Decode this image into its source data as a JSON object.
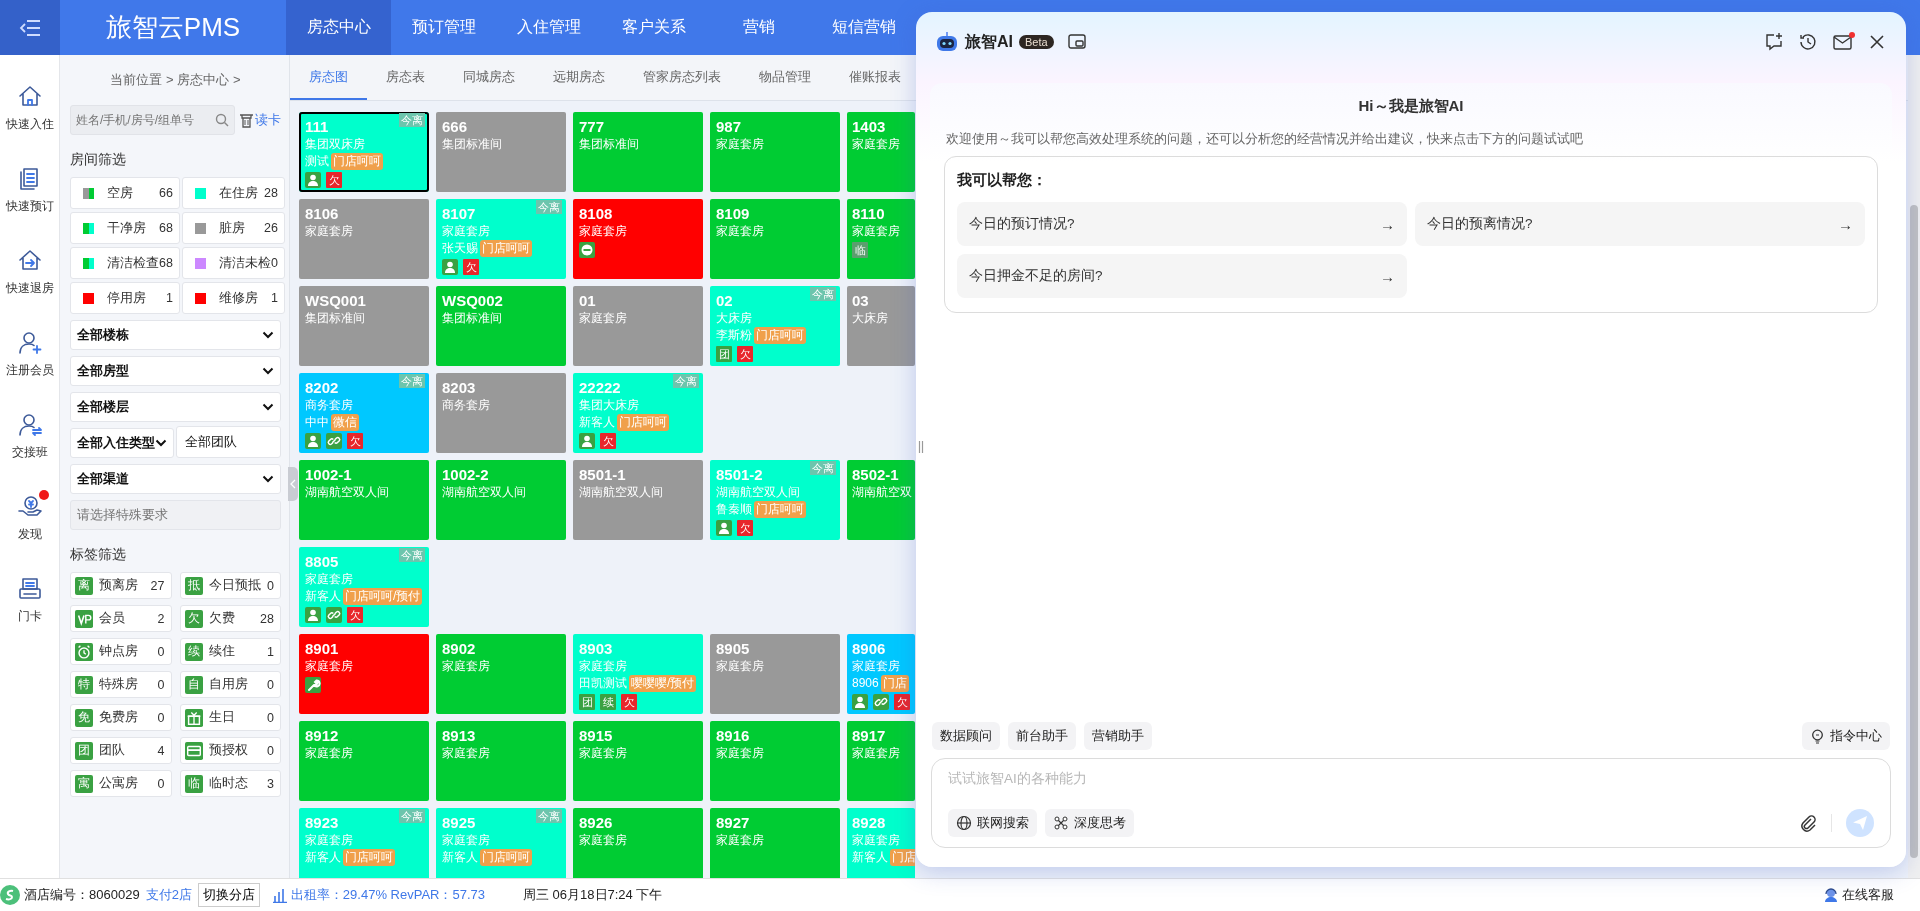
{
  "topbar": {
    "title": "旅智云PMS",
    "nav": [
      {
        "label": "房态中心",
        "selected": true
      },
      {
        "label": "预订管理",
        "selected": false
      },
      {
        "label": "入住管理",
        "selected": false
      },
      {
        "label": "客户关系",
        "selected": false
      },
      {
        "label": "营销",
        "selected": false
      },
      {
        "label": "短信营销",
        "selected": false
      }
    ]
  },
  "rail": [
    {
      "kind": "check-in",
      "label": "快速入住",
      "notify": false
    },
    {
      "kind": "booking",
      "label": "快速预订",
      "notify": false
    },
    {
      "kind": "check-out",
      "label": "快速退房",
      "notify": false
    },
    {
      "kind": "member",
      "label": "注册会员",
      "notify": false
    },
    {
      "kind": "shift",
      "label": "交接班",
      "notify": false
    },
    {
      "kind": "discover",
      "label": "发现",
      "notify": true
    },
    {
      "kind": "card",
      "label": "门卡",
      "notify": false
    }
  ],
  "filter": {
    "breadcrumb": "当前位置 > 房态中心 >",
    "search": {
      "placeholder": "姓名/手机/房号/组单号"
    },
    "card_reader": "读卡",
    "room_filter_title": "房间筛选",
    "legend": [
      {
        "label": "空房",
        "count": "66",
        "swatch": [
          {
            "color": "#999999"
          },
          {
            "color": "#00cc33"
          }
        ]
      },
      {
        "label": "在住房",
        "count": "28",
        "swatch": [
          {
            "color": "#00ffcc"
          }
        ]
      },
      {
        "label": "干净房",
        "count": "68",
        "swatch": [
          {
            "color": "#00cc33"
          },
          {
            "color": "#00ffcc"
          }
        ]
      },
      {
        "label": "脏房",
        "count": "26",
        "swatch": [
          {
            "color": "#999999"
          }
        ]
      },
      {
        "label": "清洁检查",
        "count": "68",
        "swatch": [
          {
            "color": "#00cc33"
          },
          {
            "color": "#00ffcc"
          }
        ]
      },
      {
        "label": "清洁未检",
        "count": "0",
        "swatch": [
          {
            "color": "#cc88ff"
          }
        ]
      },
      {
        "label": "停用房",
        "count": "1",
        "swatch": [
          {
            "color": "#ff0000"
          }
        ]
      },
      {
        "label": "维修房",
        "count": "1",
        "swatch": [
          {
            "color": "#ff0000"
          }
        ]
      }
    ],
    "selects": [
      {
        "kind": "select",
        "value": "全部楼栋"
      },
      {
        "kind": "select",
        "value": "全部房型"
      },
      {
        "kind": "select",
        "value": "全部楼层"
      },
      {
        "kind": "pair",
        "value": "全部入住类型",
        "extra": "全部团队"
      },
      {
        "kind": "select",
        "value": "全部渠道"
      }
    ],
    "special": {
      "placeholder": "请选择特殊要求"
    },
    "tag_filter_title": "标签筛选",
    "tags": [
      {
        "kind": "glyph",
        "glyph": "离",
        "label": "预离房",
        "count": "27"
      },
      {
        "kind": "glyph",
        "glyph": "抵",
        "label": "今日预抵",
        "count": "0"
      },
      {
        "kind": "vip",
        "label": "会员",
        "count": "2"
      },
      {
        "kind": "glyph",
        "glyph": "欠",
        "label": "欠费",
        "count": "28"
      },
      {
        "kind": "clock",
        "label": "钟点房",
        "count": "0"
      },
      {
        "kind": "glyph",
        "glyph": "续",
        "label": "续住",
        "count": "1"
      },
      {
        "kind": "glyph",
        "glyph": "特",
        "label": "特殊房",
        "count": "0"
      },
      {
        "kind": "glyph",
        "glyph": "自",
        "label": "自用房",
        "count": "0"
      },
      {
        "kind": "glyph",
        "glyph": "免",
        "label": "免费房",
        "count": "0"
      },
      {
        "kind": "gift",
        "label": "生日",
        "count": "0"
      },
      {
        "kind": "glyph",
        "glyph": "团",
        "label": "团队",
        "count": "4"
      },
      {
        "kind": "card",
        "label": "预授权",
        "count": "0"
      },
      {
        "kind": "glyph",
        "glyph": "寓",
        "label": "公寓房",
        "count": "0"
      },
      {
        "kind": "glyph",
        "glyph": "临",
        "label": "临时态",
        "count": "3"
      }
    ]
  },
  "subtabs": [
    {
      "label": "房态图",
      "selected": true
    },
    {
      "label": "房态表",
      "selected": false
    },
    {
      "label": "同城房态",
      "selected": false
    },
    {
      "label": "远期房态",
      "selected": false
    },
    {
      "label": "管家房态列表",
      "selected": false
    },
    {
      "label": "物品管理",
      "selected": false
    },
    {
      "label": "催账报表",
      "selected": false
    }
  ],
  "rooms": {
    "rows": [
      [
        {
          "number": "111",
          "type": "集团双床房",
          "guest": "测试",
          "tag": "门店呵呵",
          "departing": "今离",
          "color": "#00ffcc",
          "selected": true,
          "marks": [
            {
              "kind": "person"
            },
            {
              "kind": "label",
              "text": "欠",
              "color": "#e8262b"
            }
          ]
        },
        {
          "number": "666",
          "type": "集团标准间",
          "color": "#999999",
          "selected": false
        },
        {
          "number": "777",
          "type": "集团标准间",
          "color": "#00cc33",
          "selected": false
        },
        {
          "number": "987",
          "type": "家庭套房",
          "color": "#00cc33",
          "selected": false
        },
        {
          "number": "1403",
          "type": "家庭套房",
          "color": "#00cc33",
          "selected": false
        }
      ],
      [
        {
          "number": "8106",
          "type": "家庭套房",
          "color": "#999999",
          "selected": false
        },
        {
          "number": "8107",
          "type": "家庭套房",
          "guest": "张天赐",
          "tag": "门店呵呵",
          "departing": "今离",
          "color": "#00ffcc",
          "selected": false,
          "marks": [
            {
              "kind": "person"
            },
            {
              "kind": "label",
              "text": "欠",
              "color": "#e8262b"
            }
          ]
        },
        {
          "number": "8108",
          "type": "家庭套房",
          "color": "#ff0000",
          "selected": false,
          "marks": [
            {
              "kind": "blocked"
            }
          ]
        },
        {
          "number": "8109",
          "type": "家庭套房",
          "color": "#00cc33",
          "selected": false
        },
        {
          "number": "8110",
          "type": "家庭套房",
          "color": "#00cc33",
          "selected": false,
          "marks": [
            {
              "kind": "label",
              "text": "临",
              "color": "#5c9e6e"
            }
          ]
        }
      ],
      [
        {
          "number": "WSQ001",
          "type": "集团标准间",
          "color": "#999999",
          "selected": false
        },
        {
          "number": "WSQ002",
          "type": "集团标准间",
          "color": "#00cc33",
          "selected": false
        },
        {
          "number": "01",
          "type": "家庭套房",
          "color": "#999999",
          "selected": false
        },
        {
          "number": "02",
          "type": "大床房",
          "guest": "李斯粉",
          "tag": "门店呵呵",
          "departing": "今离",
          "color": "#00ffcc",
          "selected": false,
          "marks": [
            {
              "kind": "label",
              "text": "团",
              "color": "#3aa142"
            },
            {
              "kind": "label",
              "text": "欠",
              "color": "#e8262b"
            }
          ]
        },
        {
          "number": "03",
          "type": "大床房",
          "color": "#999999",
          "selected": false
        }
      ],
      [
        {
          "number": "8202",
          "type": "商务套房",
          "guest": "中中",
          "tag": "微信",
          "departing": "今离",
          "color": "#00c8ff",
          "selected": false,
          "marks": [
            {
              "kind": "person"
            },
            {
              "kind": "link"
            },
            {
              "kind": "label",
              "text": "欠",
              "color": "#e8262b"
            }
          ]
        },
        {
          "number": "8203",
          "type": "商务套房",
          "color": "#999999",
          "selected": false
        },
        {
          "number": "22222",
          "type": "集团大床房",
          "guest": "新客人",
          "tag": "门店呵呵",
          "departing": "今离",
          "color": "#00ffcc",
          "selected": false,
          "marks": [
            {
              "kind": "person"
            },
            {
              "kind": "label",
              "text": "欠",
              "color": "#e8262b"
            }
          ]
        }
      ],
      [
        {
          "number": "1002-1",
          "type": "湖南航空双人间",
          "color": "#00cc33",
          "selected": false
        },
        {
          "number": "1002-2",
          "type": "湖南航空双人间",
          "color": "#00cc33",
          "selected": false
        },
        {
          "number": "8501-1",
          "type": "湖南航空双人间",
          "color": "#999999",
          "selected": false
        },
        {
          "number": "8501-2",
          "type": "湖南航空双人间",
          "guest": "鲁秦顺",
          "tag": "门店呵呵",
          "departing": "今离",
          "color": "#00ffcc",
          "selected": false,
          "marks": [
            {
              "kind": "person"
            },
            {
              "kind": "label",
              "text": "欠",
              "color": "#e8262b"
            }
          ]
        },
        {
          "number": "8502-1",
          "type": "湖南航空双",
          "color": "#00cc33",
          "selected": false
        }
      ],
      [
        {
          "number": "8805",
          "type": "家庭套房",
          "guest": "新客人",
          "tag": "门店呵呵/预付",
          "departing": "今离",
          "color": "#00ffcc",
          "selected": false,
          "marks": [
            {
              "kind": "person"
            },
            {
              "kind": "link"
            },
            {
              "kind": "label",
              "text": "欠",
              "color": "#e8262b"
            }
          ]
        }
      ],
      [
        {
          "number": "8901",
          "type": "家庭套房",
          "color": "#ff0000",
          "selected": false,
          "marks": [
            {
              "kind": "repair"
            }
          ]
        },
        {
          "number": "8902",
          "type": "家庭套房",
          "color": "#00cc33",
          "selected": false
        },
        {
          "number": "8903",
          "type": "家庭套房",
          "guest": "田凯测试",
          "tag": "嘤嘤嘤/预付",
          "color": "#00ffcc",
          "selected": false,
          "marks": [
            {
              "kind": "label",
              "text": "团",
              "color": "#3aa142"
            },
            {
              "kind": "label",
              "text": "续",
              "color": "#3aa142"
            },
            {
              "kind": "label",
              "text": "欠",
              "color": "#e8262b"
            }
          ]
        },
        {
          "number": "8905",
          "type": "家庭套房",
          "color": "#999999",
          "selected": false
        },
        {
          "number": "8906",
          "type": "家庭套房",
          "guest": "8906",
          "tag": "门店",
          "color": "#00c8ff",
          "selected": false,
          "marks": [
            {
              "kind": "person"
            },
            {
              "kind": "link"
            },
            {
              "kind": "label",
              "text": "欠",
              "color": "#e8262b"
            }
          ]
        }
      ],
      [
        {
          "number": "8912",
          "type": "家庭套房",
          "color": "#00cc33",
          "selected": false
        },
        {
          "number": "8913",
          "type": "家庭套房",
          "color": "#00cc33",
          "selected": false
        },
        {
          "number": "8915",
          "type": "家庭套房",
          "color": "#00cc33",
          "selected": false
        },
        {
          "number": "8916",
          "type": "家庭套房",
          "color": "#00cc33",
          "selected": false
        },
        {
          "number": "8917",
          "type": "家庭套房",
          "color": "#00cc33",
          "selected": false
        }
      ],
      [
        {
          "number": "8923",
          "type": "家庭套房",
          "guest": "新客人",
          "tag": "门店呵呵",
          "departing": "今离",
          "color": "#00ffcc",
          "selected": false
        },
        {
          "number": "8925",
          "type": "家庭套房",
          "guest": "新客人",
          "tag": "门店呵呵",
          "departing": "今离",
          "color": "#00ffcc",
          "selected": false
        },
        {
          "number": "8926",
          "type": "家庭套房",
          "color": "#00cc33",
          "selected": false
        },
        {
          "number": "8927",
          "type": "家庭套房",
          "color": "#00cc33",
          "selected": false
        },
        {
          "number": "8928",
          "type": "家庭套房",
          "guest": "新客人",
          "tag": "门店",
          "color": "#00ffcc",
          "selected": false
        }
      ]
    ]
  },
  "ai_panel": {
    "title": "旅智AI",
    "badge": "Beta",
    "mail_unread": true,
    "greeting": "Hi～我是旅智AI",
    "intro": "欢迎使用～我可以帮您高效处理系统的问题，还可以分析您的经营情况并给出建议，快来点击下方的问题试试吧",
    "help_title": "我可以帮您：",
    "suggestions": [
      {
        "text": "今日的预订情况?",
        "arrow": "→"
      },
      {
        "text": "今日的预离情况?",
        "arrow": "→"
      },
      {
        "text": "今日押金不足的房间?",
        "arrow": "→"
      }
    ],
    "assistants": [
      "数据顾问",
      "前台助手",
      "营销助手"
    ],
    "command_center": "指令中心",
    "input": {
      "placeholder": "试试旅智AI的各种能力"
    },
    "tools": [
      {
        "kind": "web",
        "label": "联网搜索"
      },
      {
        "kind": "think",
        "label": "深度思考"
      }
    ]
  },
  "status_bar": {
    "hotel": "酒店编号：8060029",
    "pay_link": "支付2店",
    "switch_button": "切换分店",
    "occupancy": "出租率：29.47% RevPAR：57.73",
    "datetime": "周三 06月18日7:24 下午",
    "support": "在线客服"
  }
}
